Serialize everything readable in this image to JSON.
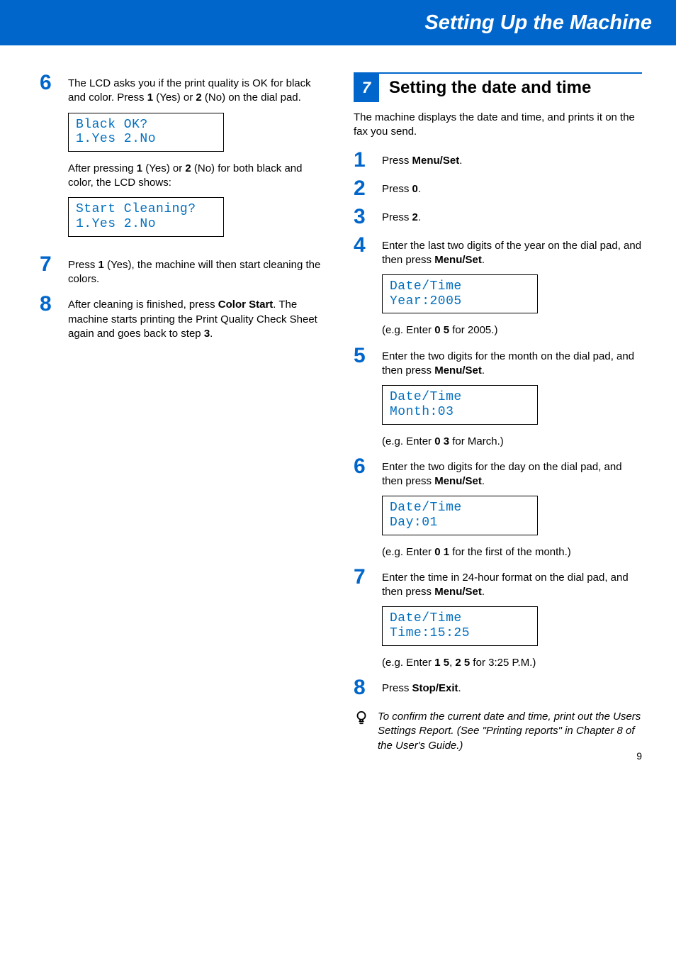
{
  "banner_title": "Setting Up the Machine",
  "left": {
    "s6": {
      "num": "6",
      "text_before": "The LCD asks you if the print quality is OK for black and color. Press ",
      "b1": "1",
      "mid1": " (Yes) or ",
      "b2": "2",
      "mid2": " (No) on the dial pad.",
      "lcd1_l1": "Black OK?",
      "lcd1_l2": "1.Yes 2.No",
      "after_before": "After pressing ",
      "ab1": "1",
      "amid1": " (Yes) or ",
      "ab2": "2",
      "amid2": " (No) for both black and color, the LCD shows:",
      "lcd2_l1": "Start Cleaning?",
      "lcd2_l2": "1.Yes 2.No"
    },
    "s7": {
      "num": "7",
      "t1": "Press ",
      "b1": "1",
      "t2": " (Yes), the machine will then start cleaning the colors."
    },
    "s8": {
      "num": "8",
      "t1": "After cleaning is finished, press ",
      "b1": "Color Start",
      "t2": ". The machine starts printing the Print Quality Check Sheet again and goes back to step ",
      "b2": "3",
      "t3": "."
    }
  },
  "right": {
    "section_num": "7",
    "section_title": "Setting the date and time",
    "intro": "The machine displays the date and time, and prints it on the fax you send.",
    "s1": {
      "num": "1",
      "t1": "Press ",
      "b1": "Menu/Set",
      "t2": "."
    },
    "s2": {
      "num": "2",
      "t1": "Press ",
      "b1": "0",
      "t2": "."
    },
    "s3": {
      "num": "3",
      "t1": "Press ",
      "b1": "2",
      "t2": "."
    },
    "s4": {
      "num": "4",
      "t1": "Enter the last two digits of the year on the dial pad, and then press ",
      "b1": "Menu/Set",
      "t2": ".",
      "lcd_l1": "Date/Time",
      "lcd_l2": "Year:2005",
      "eg1": "(e.g. Enter ",
      "egb": "0 5",
      "eg2": " for 2005.)"
    },
    "s5": {
      "num": "5",
      "t1": "Enter the two digits for the month on the dial pad, and then press ",
      "b1": "Menu/Set",
      "t2": ".",
      "lcd_l1": "Date/Time",
      "lcd_l2": "Month:03",
      "eg1": "(e.g. Enter ",
      "egb": "0 3",
      "eg2": " for March.)"
    },
    "s6": {
      "num": "6",
      "t1": "Enter the two digits for the day on the dial pad, and then press ",
      "b1": "Menu/Set",
      "t2": ".",
      "lcd_l1": "Date/Time",
      "lcd_l2": "Day:01",
      "eg1": "(e.g. Enter ",
      "egb": "0 1",
      "eg2": " for the first of the month.)"
    },
    "s7": {
      "num": "7",
      "t1": "Enter the time in 24-hour format on the dial pad, and then press ",
      "b1": "Menu/Set",
      "t2": ".",
      "lcd_l1": "Date/Time",
      "lcd_l2": "Time:15:25",
      "eg1": "(e.g. Enter ",
      "egb1": "1 5",
      "egmid": ", ",
      "egb2": "2 5",
      "eg2": " for 3:25 P.M.)"
    },
    "s8": {
      "num": "8",
      "t1": "Press ",
      "b1": "Stop/Exit",
      "t2": "."
    },
    "tip": "To confirm the current date and time, print out the Users Settings Report. (See \"Printing reports\" in Chapter 8 of the User's Guide.)"
  },
  "page_number": "9"
}
